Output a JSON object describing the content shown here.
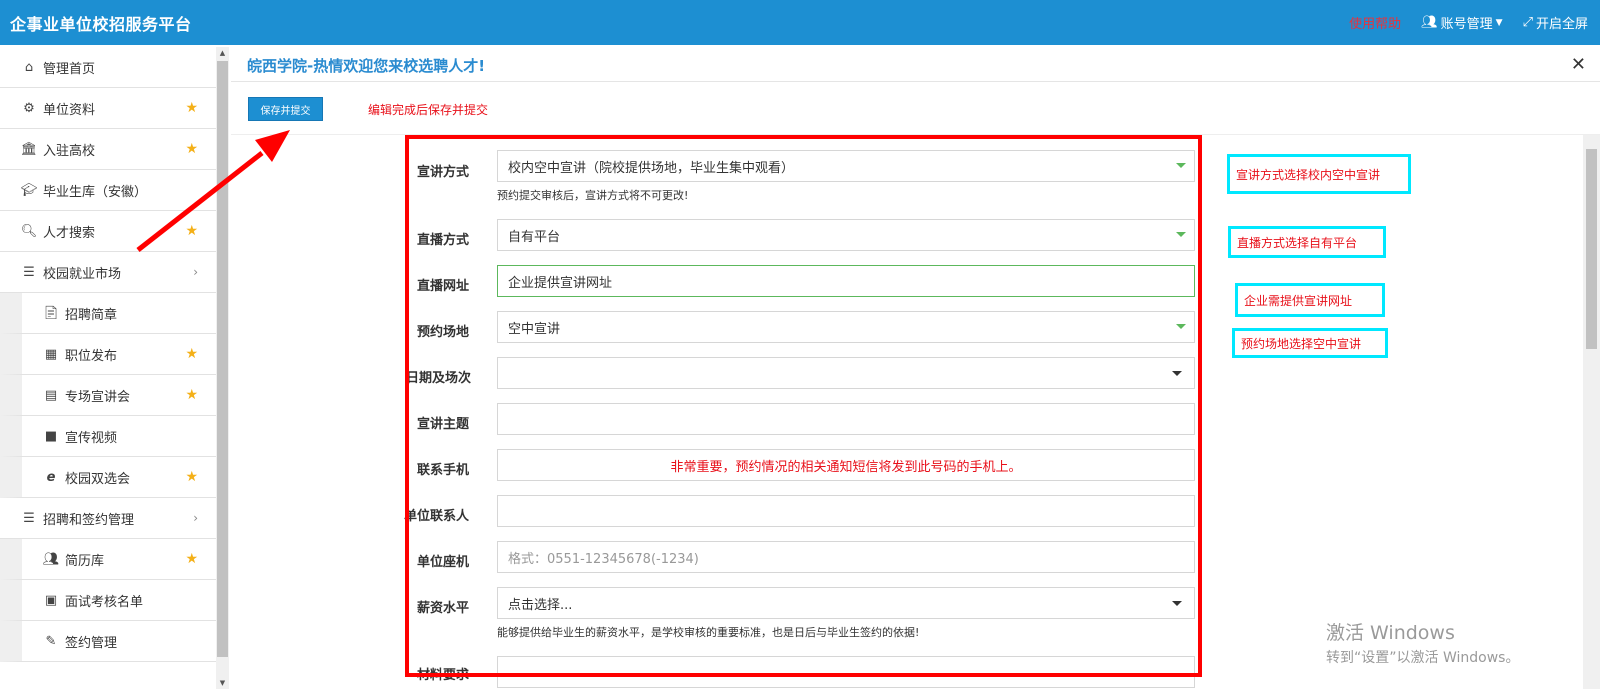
{
  "topbar": {
    "brand": "企事业单位校招服务平台",
    "help": "使用帮助",
    "account": "账号管理",
    "fullscreen": "开启全屏"
  },
  "sidebar": {
    "items": [
      {
        "label": "管理首页",
        "icon": "home-icon",
        "star": false,
        "sub": false
      },
      {
        "label": "单位资料",
        "icon": "gear-icon",
        "star": true,
        "sub": false
      },
      {
        "label": "入驻高校",
        "icon": "bank-icon",
        "star": true,
        "sub": false
      },
      {
        "label": "毕业生库（安徽）",
        "icon": "graduation-cap-icon",
        "star": false,
        "sub": false
      },
      {
        "label": "人才搜索",
        "icon": "search-icon",
        "star": true,
        "sub": false
      },
      {
        "label": "校园就业市场",
        "icon": "list-icon",
        "star": false,
        "sub": false,
        "chevron": true
      },
      {
        "label": "招聘简章",
        "icon": "file-icon",
        "star": false,
        "sub": true
      },
      {
        "label": "职位发布",
        "icon": "grid-icon",
        "star": true,
        "sub": true
      },
      {
        "label": "专场宣讲会",
        "icon": "list-alt-icon",
        "star": true,
        "sub": true
      },
      {
        "label": "宣传视频",
        "icon": "video-icon",
        "star": false,
        "sub": true
      },
      {
        "label": "校园双选会",
        "icon": "ie-icon",
        "star": true,
        "sub": true
      },
      {
        "label": "招聘和签约管理",
        "icon": "list-icon",
        "star": false,
        "sub": false,
        "chevron": true
      },
      {
        "label": "简历库",
        "icon": "users-icon",
        "star": true,
        "sub": true
      },
      {
        "label": "面试考核名单",
        "icon": "id-card-icon",
        "star": false,
        "sub": true
      },
      {
        "label": "签约管理",
        "icon": "edit-icon",
        "star": false,
        "sub": true
      }
    ]
  },
  "main": {
    "title": "皖西学院-热情欢迎您来校选聘人才!",
    "save_button": "保存并提交",
    "save_hint": "编辑完成后保存并提交"
  },
  "form": {
    "method_label": "宣讲方式",
    "method_value": "校内空中宣讲（院校提供场地，毕业生集中观看）",
    "method_hint": "预约提交审核后，宣讲方式将不可更改!",
    "live_label": "直播方式",
    "live_value": "自有平台",
    "url_label": "直播网址",
    "url_value": "企业提供宣讲网址",
    "venue_label": "预约场地",
    "venue_value": "空中宣讲",
    "date_label": "日期及场次",
    "topic_label": "宣讲主题",
    "phone_label": "联系手机",
    "phone_note": "非常重要，预约情况的相关通知短信将发到此号码的手机上。",
    "contact_label": "单位联系人",
    "landline_label": "单位座机",
    "landline_placeholder": "格式：0551-12345678(-1234)",
    "salary_label": "薪资水平",
    "salary_value": "点击选择...",
    "salary_hint": "能够提供给毕业生的薪资水平，是学校审核的重要标准，也是日后与毕业生签约的依据!",
    "material_label": "材料要求"
  },
  "annotations": {
    "method": "宣讲方式选择校内空中宣讲",
    "live": "直播方式选择自有平台",
    "url": "企业需提供宣讲网址",
    "venue": "预约场地选择空中宣讲"
  },
  "watermark": {
    "line1": "激活 Windows",
    "line2": "转到“设置”以激活 Windows。"
  },
  "colors": {
    "topbar": "#1d8fd2",
    "accent_blue": "#2a8bd0",
    "annotation_red": "#ff0000",
    "annotation_cyan": "#00e8ff",
    "star": "#f4b018"
  }
}
